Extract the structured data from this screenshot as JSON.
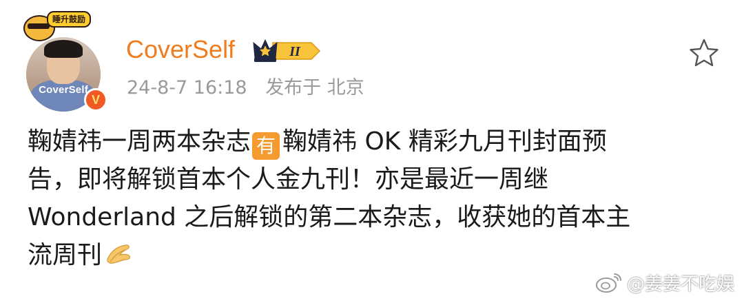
{
  "author": {
    "name": "CoverSelf",
    "avatar_text": "CoverSelf",
    "sticker_text": "睡升鼓励",
    "verified_mark": "V",
    "member_badge": "II"
  },
  "meta": {
    "time": "24-8-7 16:18",
    "posted_from": "发布于 北京"
  },
  "post": {
    "line1_a": "鞠婧祎一周两本杂志",
    "badge": "有",
    "line1_b": "鞠婧祎 OK 精彩九月刊封面预",
    "line2": "告，即将解锁首本个人金九刊！亦是最近一周继",
    "line3": " Wonderland 之后解锁的第二本杂志，收获她的首本主",
    "line4": "流周刊"
  },
  "watermark": {
    "text": "@姜姜不吃娱"
  },
  "colors": {
    "username": "#f07c1d",
    "meta_gray": "#9a9a9a",
    "badge_orange": "#f49a2e",
    "verified": "#f25a25"
  },
  "icons": {
    "favorite": "star-outline-icon",
    "verified": "verified-v-icon",
    "member": "crown-member-icon",
    "emoji": "clapping-hands-emoji",
    "watermark": "weibo-logo-icon"
  }
}
